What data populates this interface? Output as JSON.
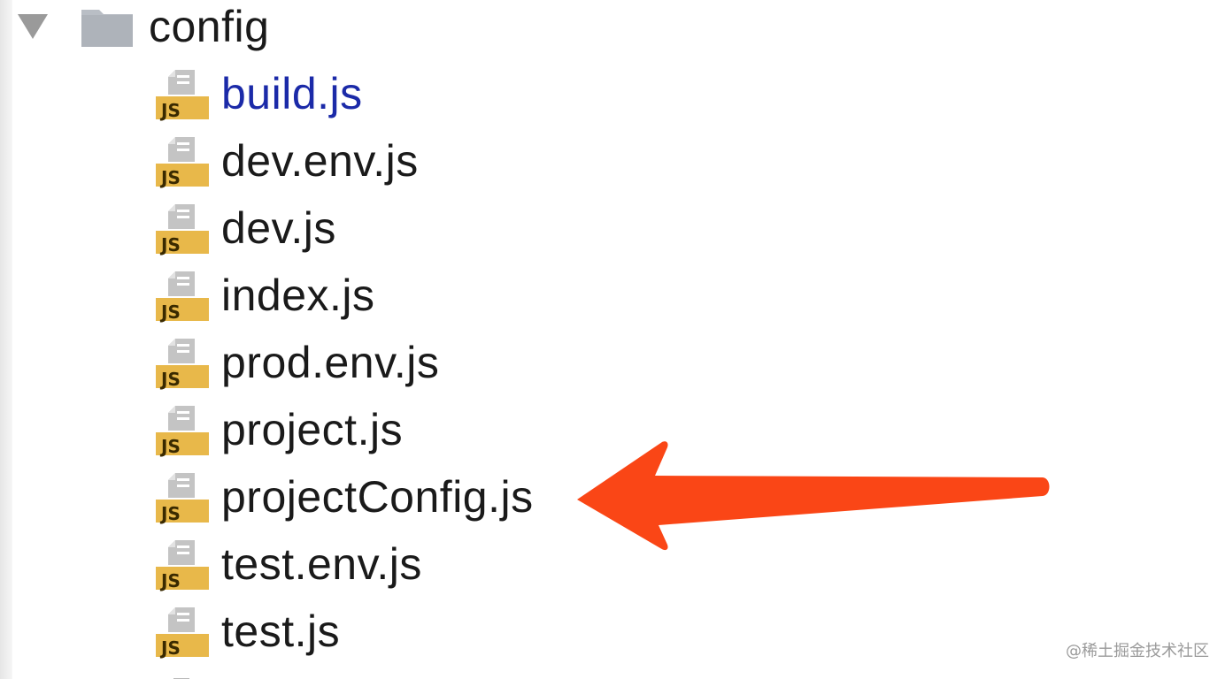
{
  "folder": {
    "name": "config",
    "expanded": true
  },
  "files": [
    {
      "name": "build.js",
      "icon": "js-file-icon",
      "color": "#1b2aa8"
    },
    {
      "name": "dev.env.js",
      "icon": "js-file-icon"
    },
    {
      "name": "dev.js",
      "icon": "js-file-icon"
    },
    {
      "name": "index.js",
      "icon": "js-file-icon"
    },
    {
      "name": "prod.env.js",
      "icon": "js-file-icon"
    },
    {
      "name": "project.js",
      "icon": "js-file-icon"
    },
    {
      "name": "projectConfig.js",
      "icon": "js-file-icon"
    },
    {
      "name": "test.env.js",
      "icon": "js-file-icon"
    },
    {
      "name": "test.js",
      "icon": "js-file-icon"
    }
  ],
  "js_badge_text": "JS",
  "annotation": {
    "type": "arrow",
    "points_to": "projectConfig.js",
    "color": "#fa4616"
  },
  "watermark": "@稀土掘金技术社区",
  "colors": {
    "badge": "#e8b84a",
    "folder": "#b9bec5",
    "page_icon": "#b8b8b8"
  }
}
